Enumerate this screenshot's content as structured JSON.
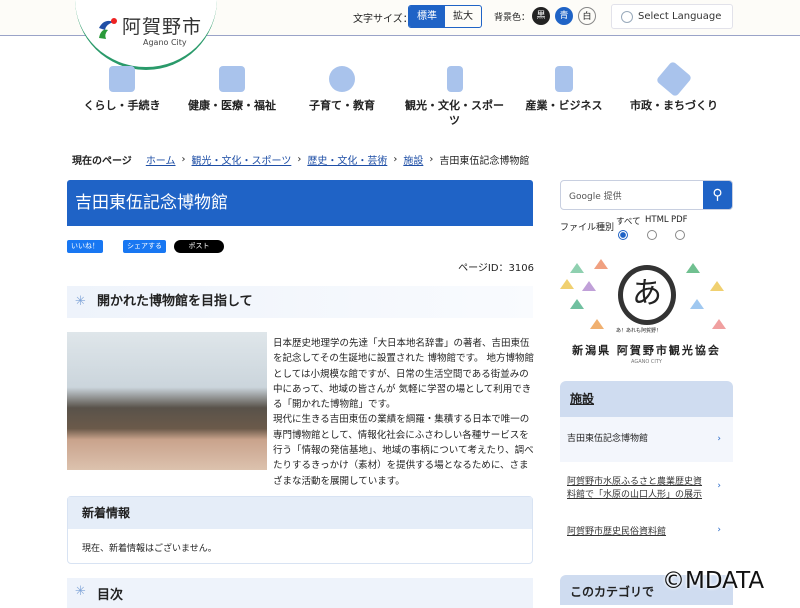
{
  "header": {
    "city_name": "阿賀野市",
    "city_sub": "Agano City",
    "font_size_label": "文字サイズ：",
    "font_size_options": [
      "標準",
      "拡大"
    ],
    "bg_label": "背景色：",
    "bg_options": [
      "黒",
      "青",
      "白"
    ],
    "language": "Select Language"
  },
  "nav": [
    {
      "label": "くらし・手続き"
    },
    {
      "label": "健康・医療・福祉"
    },
    {
      "label": "子育て・教育"
    },
    {
      "label": "観光・文化・スポーツ"
    },
    {
      "label": "産業・ビジネス"
    },
    {
      "label": "市政・まちづくり"
    }
  ],
  "breadcrumb": {
    "label": "現在のページ",
    "items": [
      "ホーム",
      "観光・文化・スポーツ",
      "歴史・文化・芸術",
      "施設"
    ],
    "current": "吉田東伍記念博物館"
  },
  "page": {
    "title": "吉田東伍記念博物館",
    "like": "いいね！",
    "share": "シェアする",
    "post": "ポスト",
    "page_id": "ページID：3106",
    "section_heading": "開かれた博物館を目指して",
    "paragraph1": "日本歴史地理学の先達「大日本地名辞書」の著者、吉田東伍を記念してその生誕地に設置された 博物館です。 地方博物館としては小規模な館ですが、日常の生活空間である街並みの中にあって、地域の皆さんが 気軽に学習の場として利用できる「開かれた博物館」です。",
    "paragraph2": "現代に生きる吉田東伍の業績を綱羅・集積する日本で唯一の専門博物館として、情報化社会にふさわしい各種サービスを行う「情報の発信基地」、地域の事柄について考えたり、調べたりするきっかけ（素材）を提供する場となるために、さまざまな活動を展開しています。",
    "news_heading": "新着情報",
    "news_body": "現在、新着情報はございません。",
    "toc_heading": "目次"
  },
  "sidebar": {
    "search_placeholder": "Google 提供",
    "file_type_label": "ファイル種別",
    "file_types": [
      "すべて",
      "HTML",
      "PDF"
    ],
    "selected_file_type": "すべて",
    "banner": {
      "tagline": "あ！あれも阿賀野！",
      "org": "新潟県 阿賀野市観光協会",
      "sub": "AGANO CITY"
    },
    "facilities_heading": "施設",
    "facilities": [
      "吉田東伍記念博物館",
      "阿賀野市水原ふるさと農業歴史資料館で「水原の山口人形」の展示",
      "阿賀野市歴史民俗資料館"
    ],
    "category_heading": "このカテゴリで"
  },
  "watermark": "©MDATA",
  "colors": {
    "accent": "#1f63c6"
  }
}
